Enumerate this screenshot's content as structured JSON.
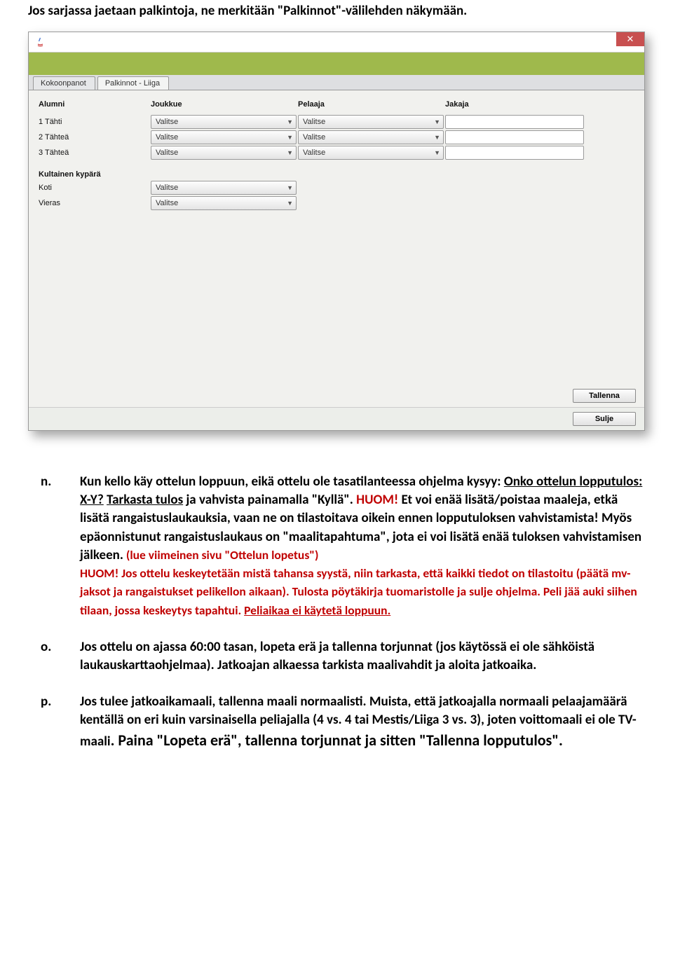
{
  "intro": "Jos sarjassa jaetaan palkintoja, ne merkitään \"Palkinnot\"-välilehden näkymään.",
  "screenshot": {
    "close_glyph": "✕",
    "tabs": [
      "Kokoonpanot",
      "Palkinnot - Liiga"
    ],
    "headers": {
      "c1": "Alumni",
      "c2": "Joukkue",
      "c3": "Pelaaja",
      "c4": "Jakaja"
    },
    "rows": [
      {
        "label": "1 Tähti",
        "dd1": "Valitse",
        "dd2": "Valitse"
      },
      {
        "label": "2 Tähteä",
        "dd1": "Valitse",
        "dd2": "Valitse"
      },
      {
        "label": "3 Tähteä",
        "dd1": "Valitse",
        "dd2": "Valitse"
      }
    ],
    "section2": "Kultainen kypärä",
    "rows2": [
      {
        "label": "Koti",
        "dd": "Valitse"
      },
      {
        "label": "Vieras",
        "dd": "Valitse"
      }
    ],
    "btn_save": "Tallenna",
    "btn_close": "Sulje"
  },
  "items": {
    "n": {
      "marker": "n.",
      "t1": "Kun kello käy ottelun loppuun, eikä ottelu ole tasatilanteessa ohjelma kysyy: ",
      "t2": "Onko ottelun lopputulos: X-Y?",
      "t3": " ",
      "t4": "Tarkasta tulos",
      "t5": " ja vahvista painamalla \"Kyllä\". ",
      "t6": "HUOM!",
      "t7": " Et voi enää lisätä/poistaa maaleja, etkä lisätä rangaistuslaukauksia, vaan ne on tilastoitava oikein ennen lopputuloksen vahvistamista! Myös epäonnistunut rangaistuslaukaus on \"maalitapahtuma\", jota ei voi lisätä enää tuloksen vahvistamisen jälkeen.",
      "t8": " (lue  viimeinen sivu \"Ottelun lopetus\")",
      "t9": "HUOM! Jos ottelu keskeytetään mistä tahansa syystä, niin tarkasta, että kaikki tiedot on tilastoitu (päätä mv-jaksot ja rangaistukset pelikellon aikaan). Tulosta pöytäkirja tuomaristolle ja sulje ohjelma. Peli jää auki siihen tilaan, jossa keskeytys tapahtui. ",
      "t10": "Peliaikaa ei käytetä loppuun."
    },
    "o": {
      "marker": "o.",
      "t1": "Jos ottelu on ajassa 60:00 tasan, lopeta erä ja tallenna torjunnat (jos käytössä ei ole sähköistä laukauskarttaohjelmaa). Jatkoajan alkaessa tarkista maalivahdit ja aloita jatkoaika."
    },
    "p": {
      "marker": "p.",
      "t1": "Jos tulee jatkoaikamaali, tallenna maali normaalisti. Muista, että jatkoajalla normaali pelaajamäärä kentällä on eri kuin varsinaisella peliajalla (4 vs. 4 tai Mestis/Liiga 3 vs. 3), joten voittomaali ei ole TV-maali",
      "t2": ". Paina \"Lopeta erä\", tallenna torjunnat ja sitten \"Tallenna lopputulos\"."
    }
  }
}
